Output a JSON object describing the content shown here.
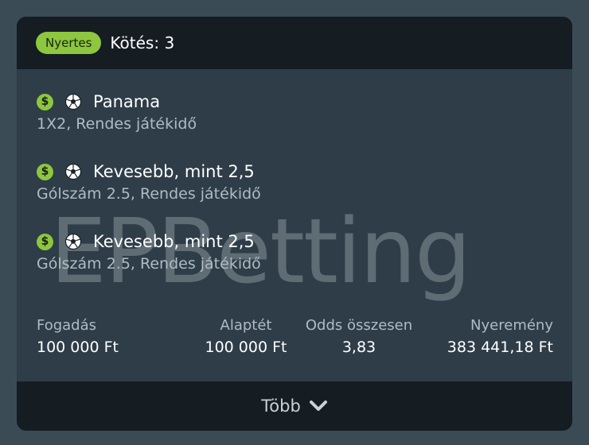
{
  "header": {
    "badge": "Nyertes",
    "title": "Kötés: 3"
  },
  "watermark": "EPBetting",
  "selections": [
    {
      "title": "Panama",
      "subtitle": "1X2, Rendes játékidő"
    },
    {
      "title": "Kevesebb, mint 2,5",
      "subtitle": "Gólszám 2.5, Rendes játékidő"
    },
    {
      "title": "Kevesebb, mint 2,5",
      "subtitle": "Gólszám 2.5, Rendes játékidő"
    }
  ],
  "icons": {
    "currency": "dollar-icon",
    "sport": "soccer-ball-icon",
    "expand": "chevron-down-icon"
  },
  "stats": {
    "stake": {
      "label": "Fogadás",
      "value": "100 000 Ft"
    },
    "base_stake": {
      "label": "Alaptét",
      "value": "100 000 Ft"
    },
    "total_odds": {
      "label": "Odds összesen",
      "value": "3,83"
    },
    "winnings": {
      "label": "Nyeremény",
      "value": "383 441,18 Ft"
    }
  },
  "footer": {
    "more_label": "Több"
  },
  "colors": {
    "accent": "#8dc63f",
    "header_bg": "#151c22",
    "card_bg": "#2e3d48",
    "page_bg": "#3a4b56"
  }
}
